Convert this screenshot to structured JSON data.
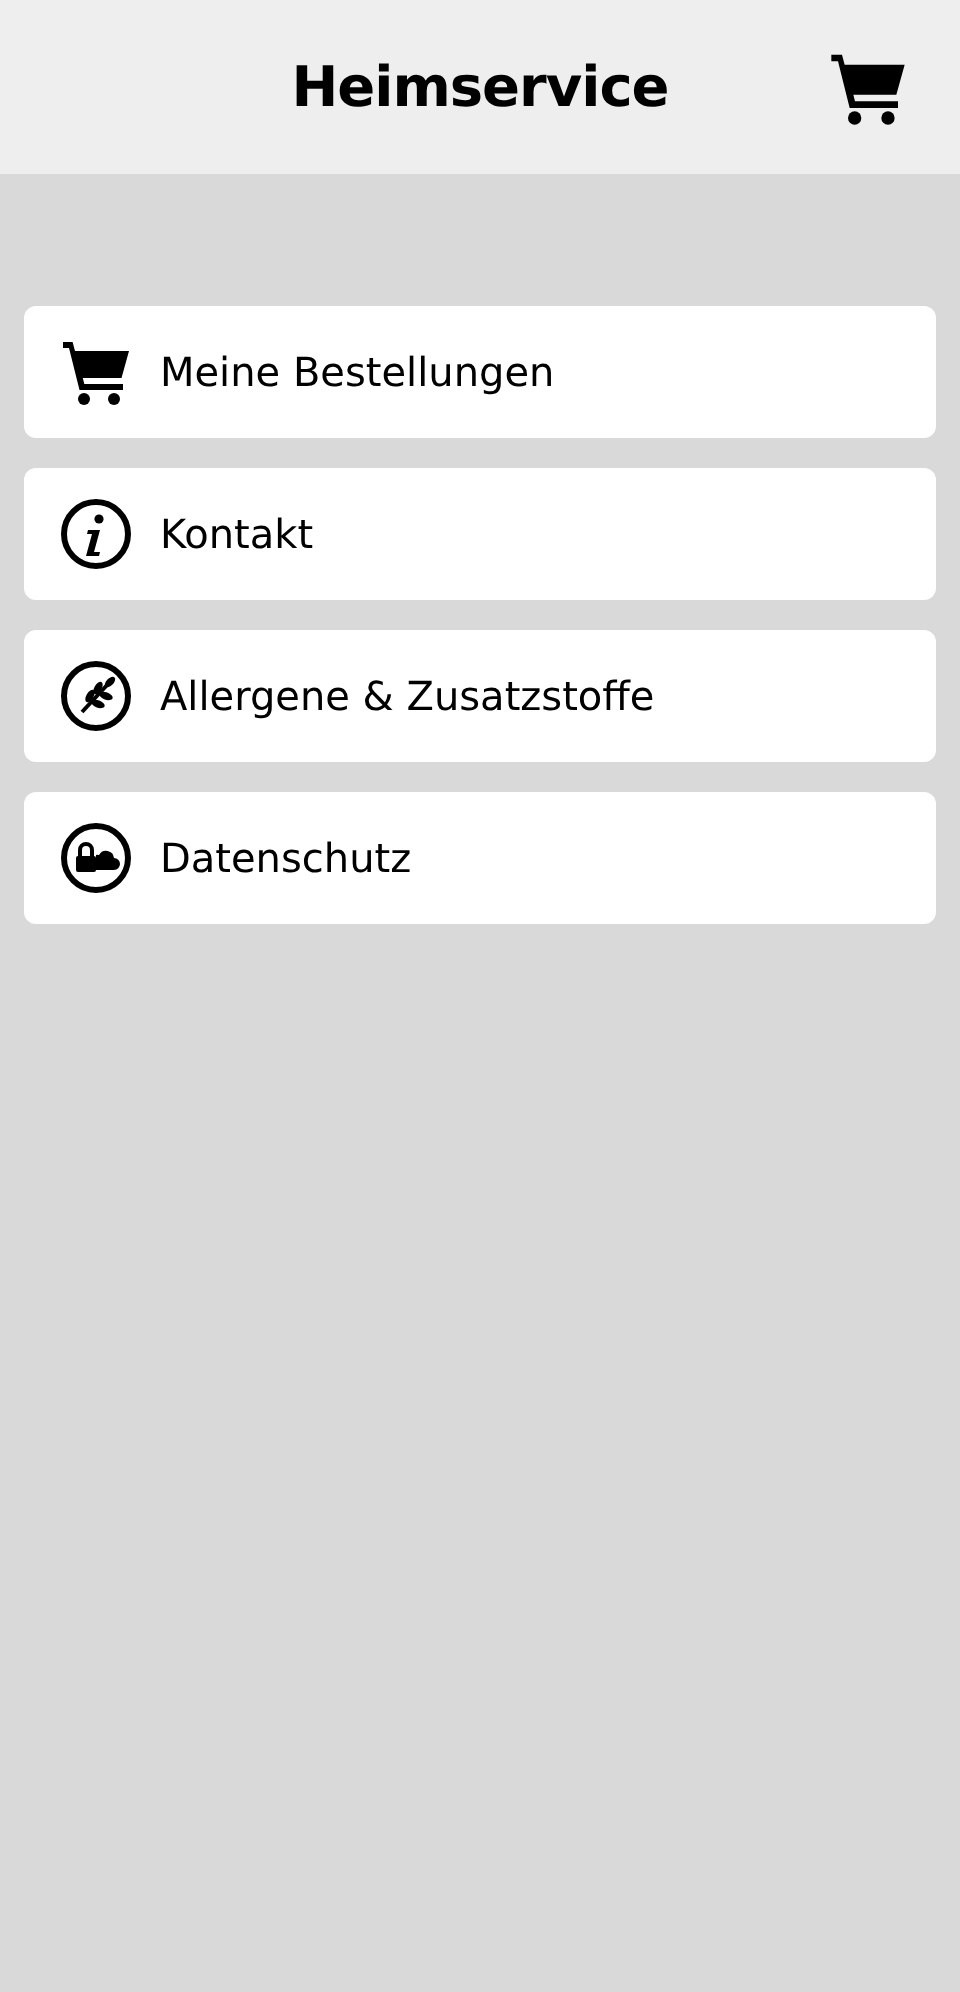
{
  "header": {
    "title": "Heimservice"
  },
  "menu": [
    {
      "label": "Meine Bestellungen",
      "kind": "cart"
    },
    {
      "label": "Kontakt",
      "kind": "info"
    },
    {
      "label": "Allergene & Zusatzstoffe",
      "kind": "grain"
    },
    {
      "label": "Datenschutz",
      "kind": "privacy"
    }
  ]
}
